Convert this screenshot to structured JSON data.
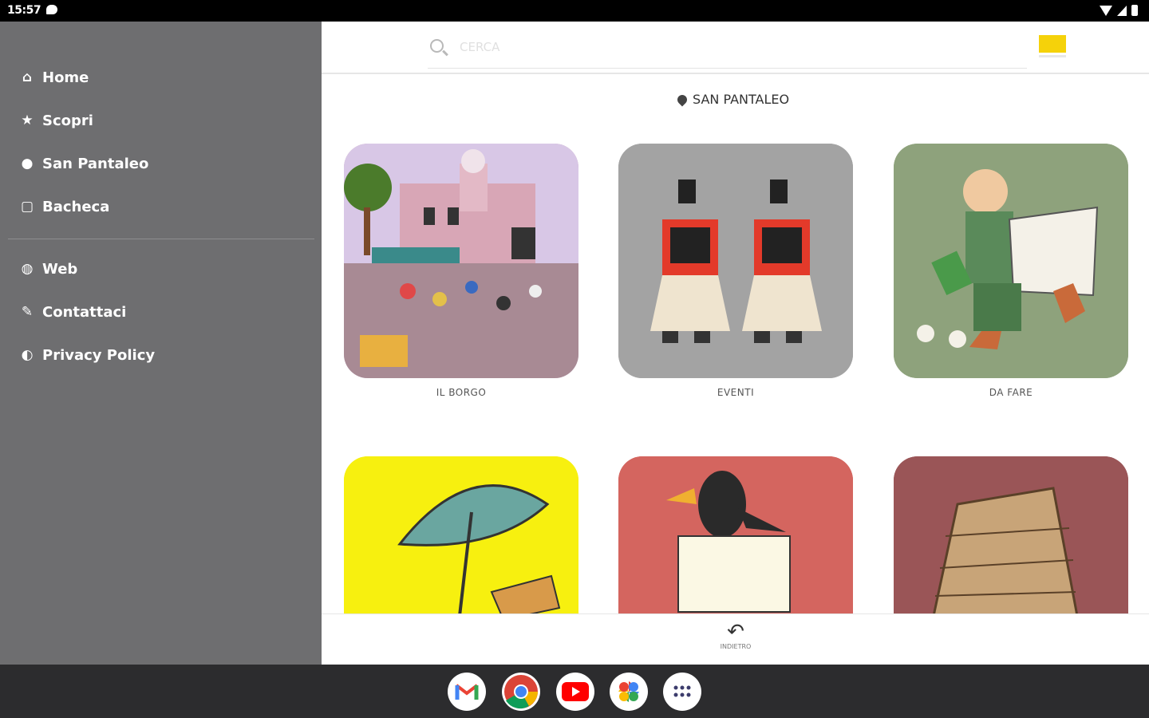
{
  "status_bar": {
    "time": "15:57"
  },
  "drawer": {
    "items": [
      {
        "label": "Home",
        "icon": "home-icon",
        "glyph": "⌂"
      },
      {
        "label": "Scopri",
        "icon": "star-icon",
        "glyph": "★"
      },
      {
        "label": "San Pantaleo",
        "icon": "map-pin-icon",
        "glyph": "●"
      },
      {
        "label": "Bacheca",
        "icon": "clipboard-icon",
        "glyph": "▢"
      },
      {
        "label": "Web",
        "icon": "globe-icon",
        "glyph": "◍"
      },
      {
        "label": "Contattaci",
        "icon": "edit-icon",
        "glyph": "✎"
      },
      {
        "label": "Privacy Policy",
        "icon": "shield-icon",
        "glyph": "◐"
      }
    ]
  },
  "search": {
    "placeholder": "CERCA"
  },
  "location": {
    "label": "SAN PANTALEO"
  },
  "tiles": [
    {
      "label": "IL BORGO",
      "bg": "#c9a7b6"
    },
    {
      "label": "EVENTI",
      "bg": "#a3a3a3"
    },
    {
      "label": "DA FARE",
      "bg": "#8ea27c"
    },
    {
      "label": "",
      "bg": "#f7f00f"
    },
    {
      "label": "",
      "bg": "#d4655f"
    },
    {
      "label": "",
      "bg": "#9a5557"
    }
  ],
  "bottom": {
    "back_label": "INDIETRO"
  },
  "taskbar": {
    "apps": [
      {
        "name": "Gmail"
      },
      {
        "name": "Chrome"
      },
      {
        "name": "YouTube"
      },
      {
        "name": "Photos"
      },
      {
        "name": "Apps"
      }
    ]
  },
  "colors": {
    "drawer": "#6e6e70",
    "accent": "#f5d20a",
    "taskbar": "#2c2c2e"
  }
}
